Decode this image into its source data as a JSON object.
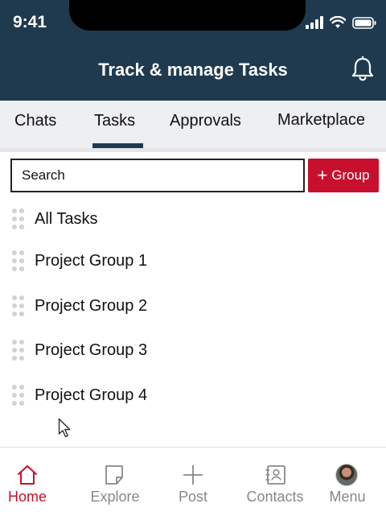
{
  "status_bar": {
    "time": "9:41",
    "signal_icon": "cellular-signal-icon",
    "wifi_icon": "wifi-icon",
    "battery_icon": "battery-icon"
  },
  "header": {
    "title": "Track & manage Tasks",
    "bell_icon": "bell-icon"
  },
  "tabs": [
    {
      "label": "Chats"
    },
    {
      "label": "Tasks",
      "active": true
    },
    {
      "label": "Approvals"
    },
    {
      "label": "Marketplace"
    }
  ],
  "search": {
    "placeholder": "Search"
  },
  "group_button": {
    "icon": "plus-icon",
    "label": "Group"
  },
  "list": [
    {
      "label": "All Tasks"
    },
    {
      "label": "Project Group 1"
    },
    {
      "label": "Project Group 2"
    },
    {
      "label": "Project Group 3"
    },
    {
      "label": "Project Group 4"
    }
  ],
  "bottom_nav": [
    {
      "label": "Home",
      "icon": "home-icon",
      "active": true
    },
    {
      "label": "Explore",
      "icon": "note-icon"
    },
    {
      "label": "Post",
      "icon": "plus-icon"
    },
    {
      "label": "Contacts",
      "icon": "contacts-icon"
    },
    {
      "label": "Menu",
      "icon": "avatar"
    }
  ],
  "colors": {
    "header_bg": "#1f3a4f",
    "accent": "#c8102e",
    "tab_bg": "#eeeff2"
  }
}
